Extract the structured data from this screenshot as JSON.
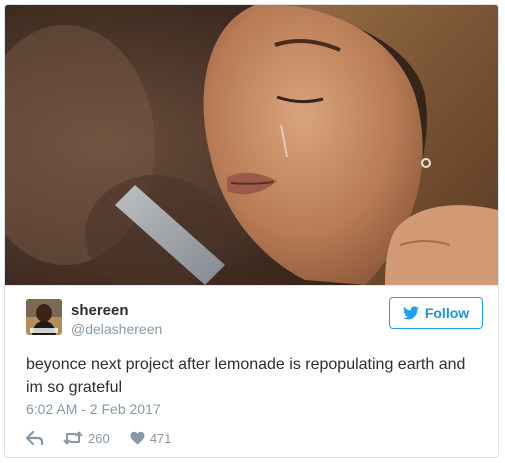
{
  "colors": {
    "accent": "#1da1f2",
    "text": "#292f33",
    "muted": "#8899a6",
    "border": "#e1e8ed"
  },
  "media": {
    "icon": "photo-of-crying-woman"
  },
  "author": {
    "name": "shereen",
    "handle": "@delashereen",
    "avatar_icon": "profile-picture"
  },
  "follow_button": {
    "label": "Follow",
    "icon": "twitter-bird-icon"
  },
  "tweet": {
    "text": "beyonce next project after lemonade is repopulating earth and im so grateful",
    "timestamp": "6:02 AM - 2 Feb 2017"
  },
  "actions": {
    "reply_icon": "reply-icon",
    "retweet_icon": "retweet-icon",
    "retweet_count": "260",
    "like_icon": "heart-icon",
    "like_count": "471"
  }
}
